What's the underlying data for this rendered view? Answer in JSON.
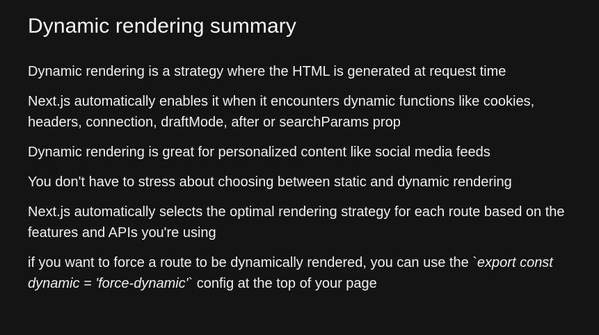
{
  "title": "Dynamic rendering summary",
  "bullets": [
    "Dynamic rendering is a strategy where the HTML is generated at request time",
    "Next.js automatically enables it when it encounters dynamic functions like cookies, headers, connection, draftMode, after or searchParams prop",
    "Dynamic rendering is great for personalized content like social media feeds",
    "You don't have to stress about choosing between static and dynamic rendering",
    "Next.js automatically selects the optimal rendering strategy for each route based on the features and APIs you're using"
  ],
  "last_bullet": {
    "prefix": "if you want to force a route to be dynamically rendered, you can use the `",
    "code": "export const dynamic = 'force-dynamic'",
    "suffix": "` config at the top of your page"
  }
}
